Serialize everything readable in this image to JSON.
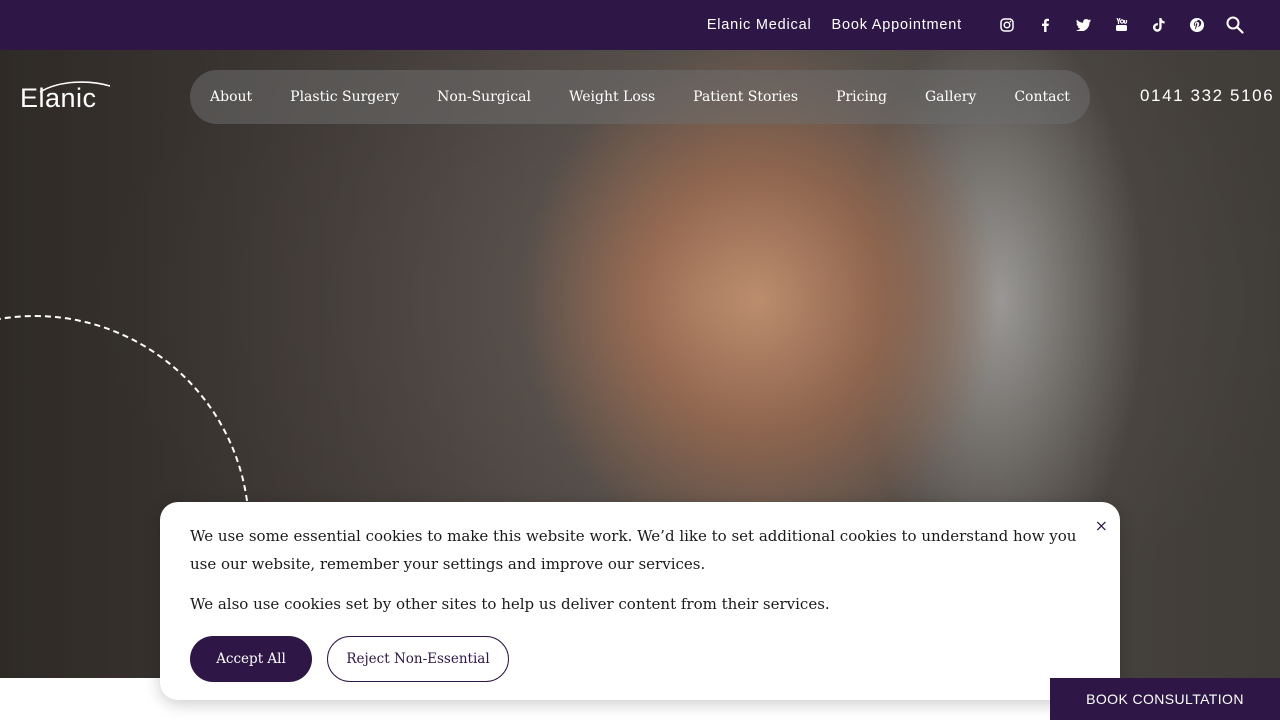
{
  "topbar": {
    "links": [
      "Elanic Medical",
      "Book Appointment"
    ],
    "social_icons": [
      "instagram-icon",
      "facebook-icon",
      "twitter-icon",
      "youtube-icon",
      "tiktok-icon",
      "pinterest-icon",
      "search-icon"
    ]
  },
  "header": {
    "logo_text": "Elanic",
    "nav": [
      "About",
      "Plastic Surgery",
      "Non-Surgical",
      "Weight Loss",
      "Patient Stories",
      "Pricing",
      "Gallery",
      "Contact"
    ],
    "phone": "0141 332 5106"
  },
  "cookie": {
    "text1": "We use some essential cookies to make this website work. We’d like to set additional cookies to understand how you use our website, remember your settings and improve our services.",
    "text2": "We also use cookies set by other sites to help us deliver content from their services.",
    "accept_label": "Accept All",
    "reject_label": "Reject Non-Essential",
    "close_label": "×"
  },
  "book_button": "BOOK CONSULTATION",
  "colors": {
    "brand": "#2e1746",
    "white": "#ffffff"
  }
}
